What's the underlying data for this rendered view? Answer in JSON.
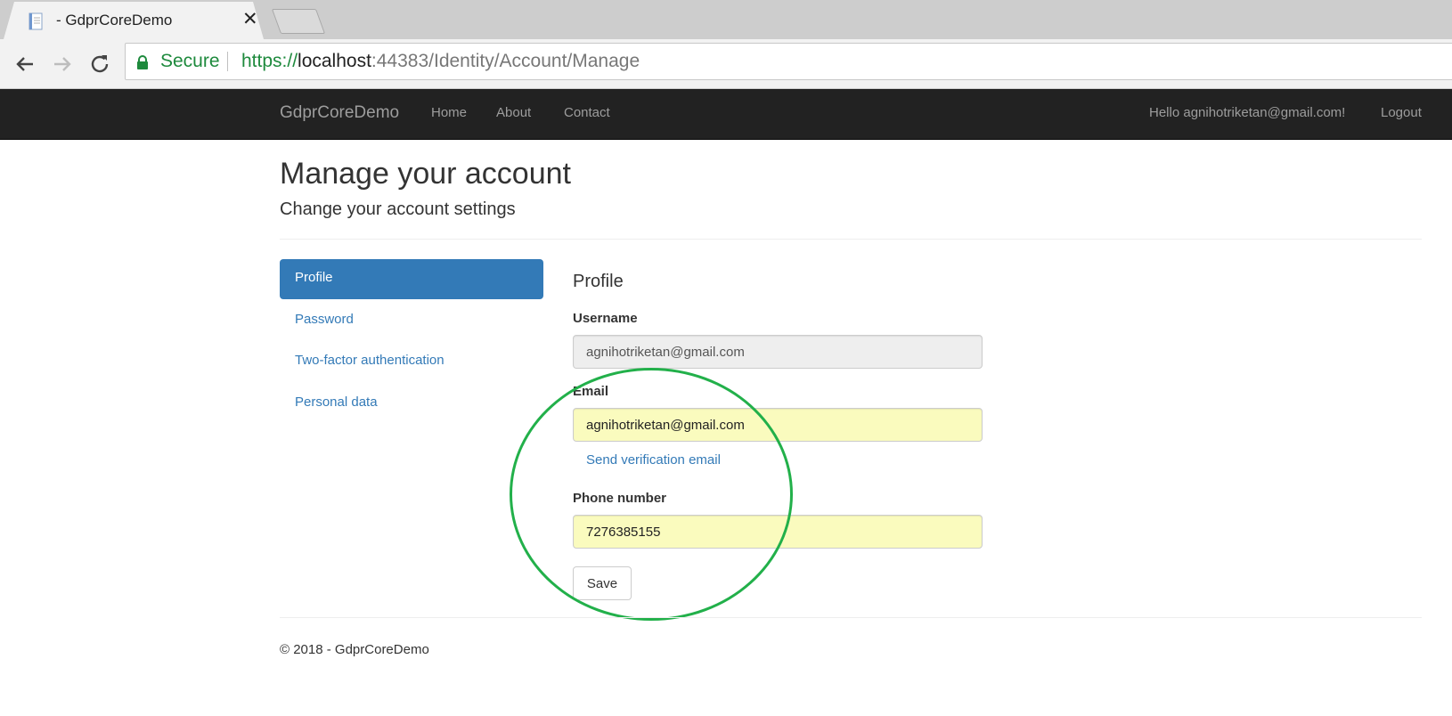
{
  "browser": {
    "tab_title": "- GdprCoreDemo",
    "security_label": "Secure",
    "url": {
      "scheme": "https://",
      "host": "localhost",
      "rest": ":44383/Identity/Account/Manage"
    }
  },
  "navbar": {
    "brand": "GdprCoreDemo",
    "links": [
      "Home",
      "About",
      "Contact"
    ],
    "greeting": "Hello agnihotriketan@gmail.com!",
    "logout": "Logout"
  },
  "page": {
    "title": "Manage your account",
    "subtitle": "Change your account settings"
  },
  "sidenav": {
    "items": [
      {
        "label": "Profile",
        "active": true
      },
      {
        "label": "Password",
        "active": false
      },
      {
        "label": "Two-factor authentication",
        "active": false
      },
      {
        "label": "Personal data",
        "active": false
      }
    ]
  },
  "profile": {
    "heading": "Profile",
    "username_label": "Username",
    "username_value": "agnihotriketan@gmail.com",
    "email_label": "Email",
    "email_value": "agnihotriketan@gmail.com",
    "send_verification": "Send verification email",
    "phone_label": "Phone number",
    "phone_value": "7276385155",
    "save_label": "Save"
  },
  "footer": {
    "text": "© 2018 - GdprCoreDemo"
  },
  "colors": {
    "navbar_bg": "#222222",
    "link": "#337ab7",
    "active_nav_bg": "#337ab7",
    "secure_green": "#1e8a3d",
    "autofill_bg": "#fafbbe",
    "annotation_circle": "#22b04a"
  }
}
